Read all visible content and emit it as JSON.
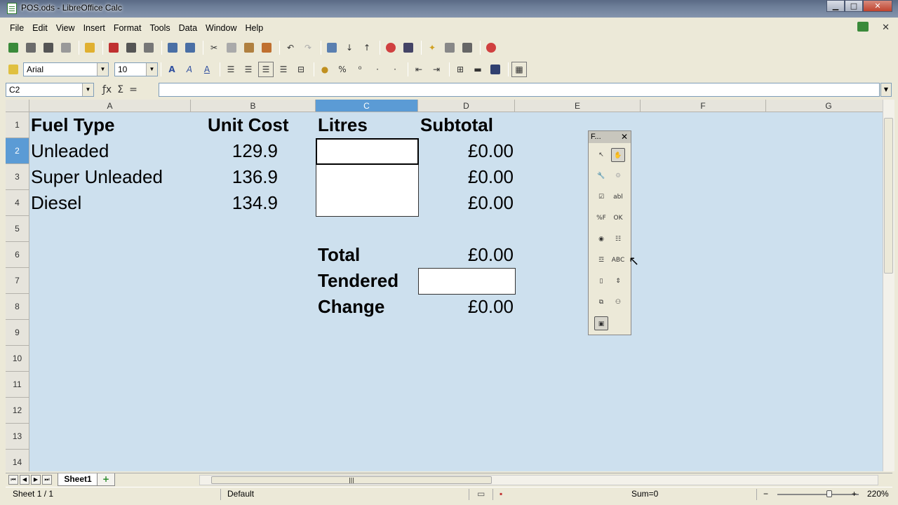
{
  "window": {
    "title": "POS.ods - LibreOffice Calc"
  },
  "menu": [
    "File",
    "Edit",
    "View",
    "Insert",
    "Format",
    "Tools",
    "Data",
    "Window",
    "Help"
  ],
  "format_bar": {
    "font_name": "Arial",
    "font_size": "10"
  },
  "formula_bar": {
    "name_box": "C2",
    "formula": ""
  },
  "columns": [
    "A",
    "B",
    "C",
    "D",
    "E",
    "F",
    "G"
  ],
  "selected_column": "C",
  "rows": [
    "1",
    "2",
    "3",
    "4",
    "5",
    "6",
    "7",
    "8",
    "9",
    "10",
    "11",
    "12",
    "13",
    "14"
  ],
  "selected_row": "2",
  "sheet": {
    "headers": {
      "fuel_type": "Fuel Type",
      "unit_cost": "Unit Cost",
      "litres": "Litres",
      "subtotal": "Subtotal"
    },
    "items": [
      {
        "fuel": "Unleaded",
        "cost": "129.9",
        "litres": "",
        "subtotal": "£0.00"
      },
      {
        "fuel": "Super Unleaded",
        "cost": "136.9",
        "litres": "",
        "subtotal": "£0.00"
      },
      {
        "fuel": "Diesel",
        "cost": "134.9",
        "litres": "",
        "subtotal": "£0.00"
      }
    ],
    "total_label": "Total",
    "total_value": "£0.00",
    "tendered_label": "Tendered",
    "tendered_value": "",
    "change_label": "Change",
    "change_value": "£0.00"
  },
  "sheet_tab": "Sheet1",
  "status": {
    "sheet_pos": "Sheet 1 / 1",
    "page_style": "Default",
    "sum": "Sum=0",
    "zoom": "220%"
  },
  "form_toolbar": {
    "title": "F..."
  }
}
